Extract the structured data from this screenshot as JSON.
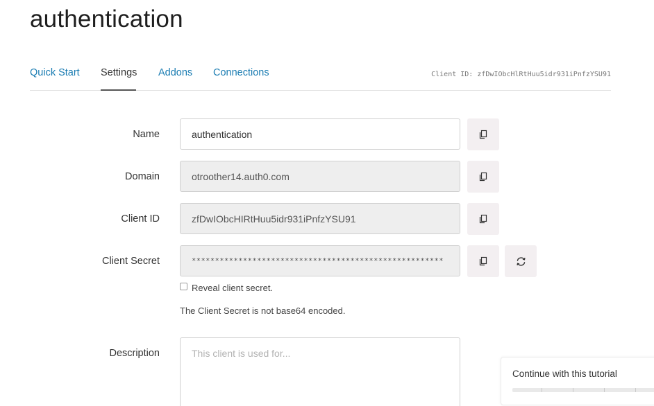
{
  "page": {
    "title": "authentication"
  },
  "tabs": [
    {
      "label": "Quick Start",
      "active": false
    },
    {
      "label": "Settings",
      "active": true
    },
    {
      "label": "Addons",
      "active": false
    },
    {
      "label": "Connections",
      "active": false
    }
  ],
  "header": {
    "client_id_label": "Client ID: zfDwIObcHlRtHuu5idr931iPnfzYSU91"
  },
  "fields": {
    "name": {
      "label": "Name",
      "value": "authentication"
    },
    "domain": {
      "label": "Domain",
      "value": "otroother14.auth0.com"
    },
    "client_id": {
      "label": "Client ID",
      "value": "zfDwIObcHIRtHuu5idr931iPnfzYSU91"
    },
    "client_secret": {
      "label": "Client Secret",
      "value": "******************************************************"
    },
    "description": {
      "label": "Description",
      "placeholder": "This client is used for..."
    }
  },
  "secret": {
    "reveal_label": "Reveal client secret.",
    "reveal_checked": false,
    "encoding_note": "The Client Secret is not base64 encoded."
  },
  "tutorial": {
    "label": "Continue with this tutorial",
    "progress": 0
  },
  "icons": {
    "copy": "copy-icon",
    "rotate": "rotate-icon"
  },
  "colors": {
    "link": "#1a7cb2",
    "button_bg": "#f3eff1",
    "readonly_bg": "#eeeeee"
  }
}
